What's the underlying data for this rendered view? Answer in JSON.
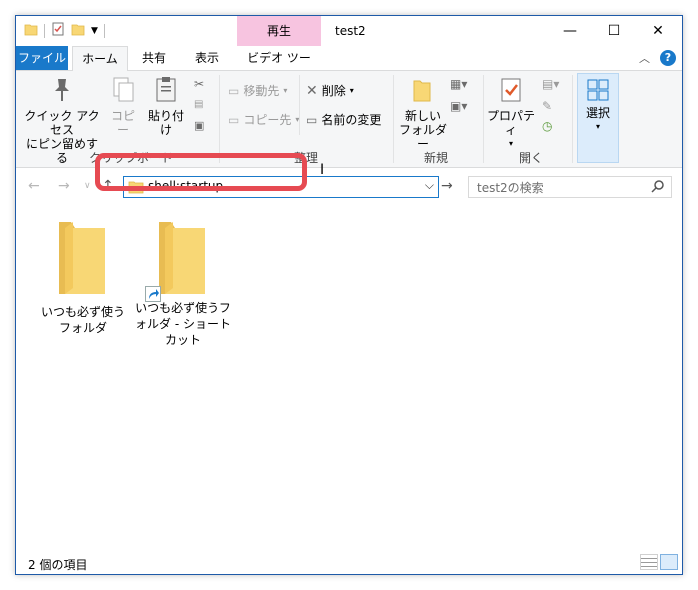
{
  "titlebar": {
    "context_tab": "再生",
    "title": "test2",
    "minimize": "—",
    "maximize": "☐",
    "close": "✕"
  },
  "tabs": {
    "file": "ファイル",
    "home": "ホーム",
    "share": "共有",
    "view": "表示",
    "video_tools": "ビデオ ツール"
  },
  "ribbon": {
    "clipboard": {
      "pin": "クイック アクセス\nにピン留めする",
      "copy": "コピー",
      "paste": "貼り付け",
      "label": "クリップボード"
    },
    "organize": {
      "move_to": "移動先",
      "copy_to": "コピー先",
      "delete": "削除",
      "rename": "名前の変更",
      "label": "整理"
    },
    "new": {
      "new_folder": "新しい\nフォルダー",
      "label": "新規"
    },
    "open": {
      "properties": "プロパティ",
      "label": "開く"
    },
    "select": {
      "select": "選択"
    }
  },
  "address": {
    "value": "shell:startup",
    "search_placeholder": "test2の検索"
  },
  "items": [
    {
      "name": "いつも必ず使うフォルダ",
      "shortcut": false
    },
    {
      "name": "いつも必ず使うフォルダ - ショートカット",
      "shortcut": true
    }
  ],
  "status": {
    "count": "2 個の項目"
  },
  "colors": {
    "accent": "#1979ca",
    "highlight": "#e64a52",
    "context_tab": "#f7c4e0",
    "folder": "#f8d775"
  }
}
